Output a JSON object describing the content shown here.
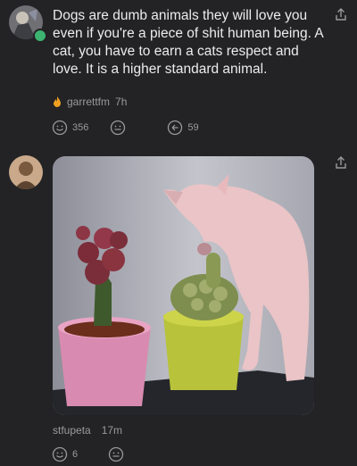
{
  "post1": {
    "text": "Dogs are dumb animals they will love you even if you're a piece of shit human being. A cat, you have to earn a cats respect and love. It is a higher standard animal.",
    "username": "garrettfm",
    "time": "7h",
    "likes": "356",
    "replies": "59"
  },
  "post2": {
    "username": "stfupeta",
    "time": "17m",
    "likes": "6"
  },
  "colors": {
    "background": "#232326",
    "badge": "#3cb371",
    "fire": "#f0a020"
  }
}
